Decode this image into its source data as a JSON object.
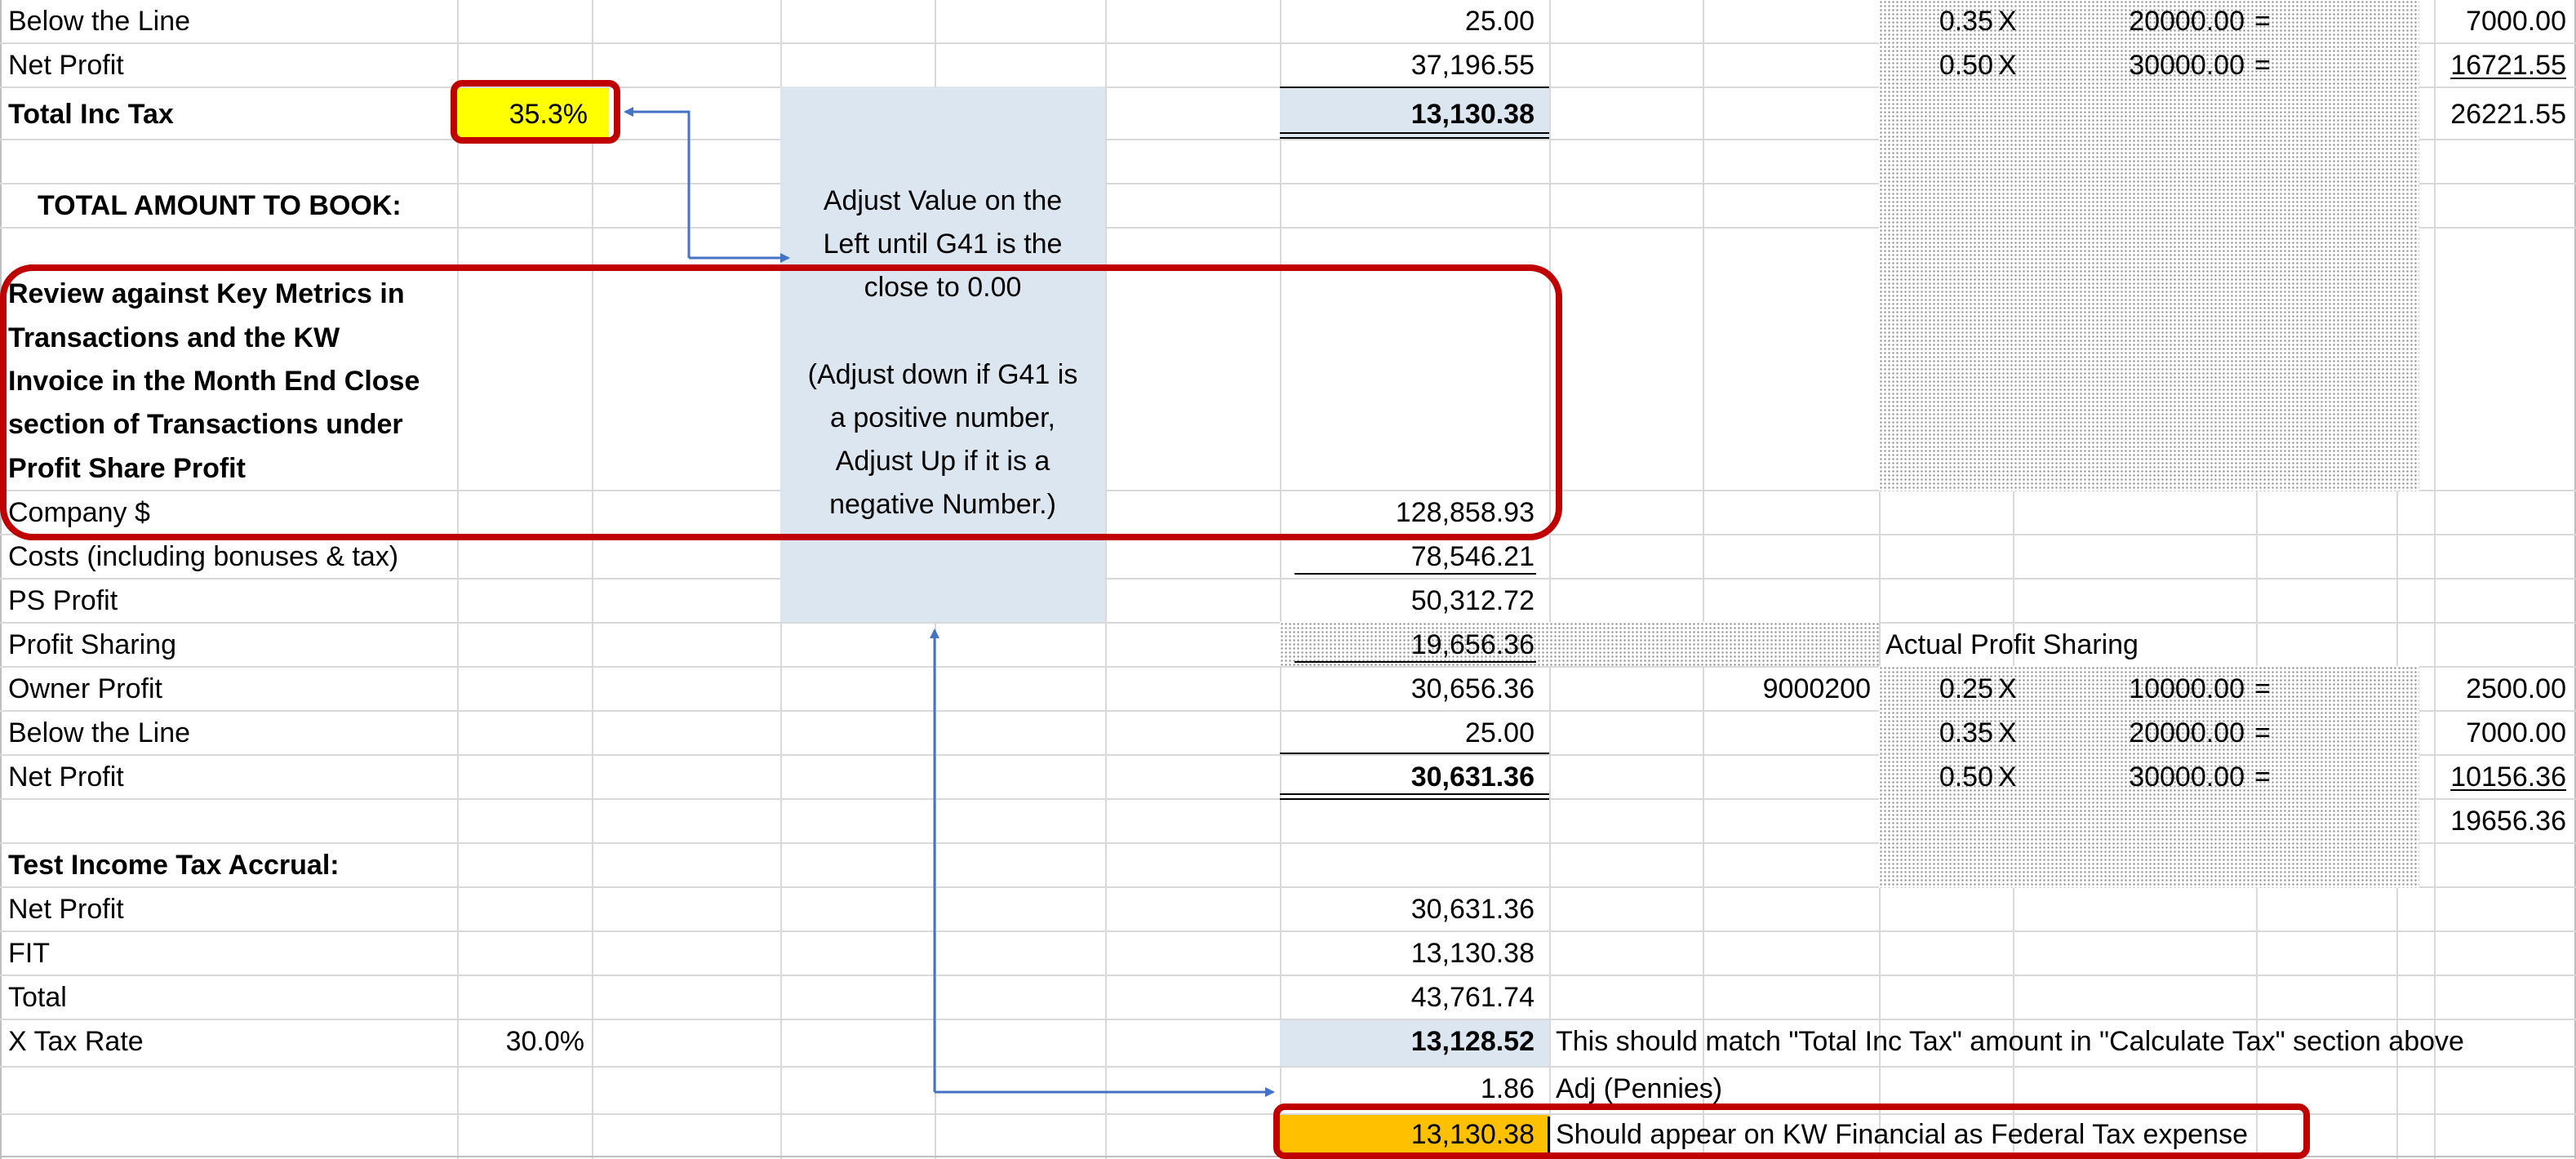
{
  "colors": {
    "gridline": "#d9d9d9",
    "highlight_yellow": "#ffff00",
    "highlight_orange": "#ffc000",
    "note_fill": "#dce6f1",
    "total_fill": "#dce6f1",
    "callout_border": "#c00000",
    "arrow": "#4472c4"
  },
  "top_section": {
    "below_the_line": {
      "label": "Below the Line",
      "value": "25.00"
    },
    "net_profit": {
      "label": "Net Profit",
      "value": "37,196.55"
    },
    "total_inc_tax": {
      "label": "Total Inc Tax",
      "rate": "35.3%",
      "value": "13,130.38"
    },
    "total_amount_to_book": "TOTAL AMOUNT TO BOOK:",
    "tax_calc_rows": [
      {
        "rate": "0.35",
        "x": "X",
        "amount": "20000.00",
        "eq": "=",
        "result": "7000.00"
      },
      {
        "rate": "0.50",
        "x": "X",
        "amount": "30000.00",
        "eq": "=",
        "result": "16721.55"
      }
    ],
    "tax_calc_total": "26221.55"
  },
  "review_note": {
    "line1": "Review against Key Metrics in",
    "line2": "Transactions and the KW",
    "line3": "Invoice in the Month End Close",
    "line4": "section of Transactions under",
    "line5": "Profit Share Profit"
  },
  "instruction_note": {
    "line1": "Adjust Value on the",
    "line2": "Left until G41 is the",
    "line3": "close to 0.00",
    "line4": "(Adjust down if G41 is",
    "line5": "a positive number,",
    "line6": "Adjust Up if it is a",
    "line7": "negative Number.)"
  },
  "profit_section": {
    "company": {
      "label": "Company $",
      "value": "128,858.93"
    },
    "costs": {
      "label": "Costs (including bonuses & tax)",
      "value": "78,546.21"
    },
    "ps_profit": {
      "label": "PS Profit",
      "value": "50,312.72"
    },
    "profit_sharing": {
      "label": "Profit Sharing",
      "value": "19,656.36"
    },
    "owner_profit": {
      "label": "Owner Profit",
      "value": "30,656.36",
      "ref": "9000200"
    },
    "below_the_line": {
      "label": "Below the Line",
      "value": "25.00"
    },
    "net_profit": {
      "label": "Net Profit",
      "value": "30,631.36"
    }
  },
  "actual_profit_sharing": {
    "title": "Actual Profit Sharing",
    "rows": [
      {
        "rate": "0.25",
        "x": "X",
        "amount": "10000.00",
        "eq": "=",
        "result": "2500.00"
      },
      {
        "rate": "0.35",
        "x": "X",
        "amount": "20000.00",
        "eq": "=",
        "result": "7000.00"
      },
      {
        "rate": "0.50",
        "x": "X",
        "amount": "30000.00",
        "eq": "=",
        "result": "10156.36"
      }
    ],
    "total": "19656.36"
  },
  "test_section": {
    "title": "Test Income Tax Accrual:",
    "net_profit": {
      "label": "Net Profit",
      "value": "30,631.36"
    },
    "fit": {
      "label": "FIT",
      "value": "13,130.38"
    },
    "total": {
      "label": "Total",
      "value": "43,761.74"
    },
    "tax_rate": {
      "label": "X Tax Rate",
      "rate": "30.0%",
      "value": "13,128.52",
      "note": "This should match \"Total Inc Tax\" amount in \"Calculate Tax\" section above"
    },
    "adj": {
      "value": "1.86",
      "note": "Adj (Pennies)"
    },
    "final": {
      "value": "13,130.38",
      "note": "Should appear on KW Financial as Federal Tax expense"
    }
  }
}
